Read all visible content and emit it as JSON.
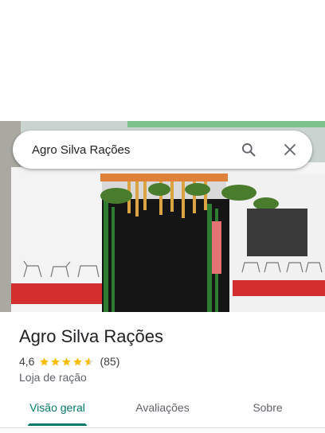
{
  "search": {
    "query": "Agro Silva Rações",
    "search_icon": "search-icon",
    "clear_icon": "close-icon"
  },
  "photo": {
    "subject": "store-front-photo"
  },
  "place": {
    "name": "Agro Silva Rações",
    "rating": "4,6",
    "stars": 4.6,
    "review_count": "(85)",
    "category": "Loja de ração"
  },
  "tabs": [
    {
      "label": "Visão geral",
      "active": true
    },
    {
      "label": "Avaliações",
      "active": false
    },
    {
      "label": "Sobre",
      "active": false
    }
  ],
  "colors": {
    "accent": "#00796b",
    "star": "#fbbc04",
    "stripe_red": "#d32f2f"
  }
}
